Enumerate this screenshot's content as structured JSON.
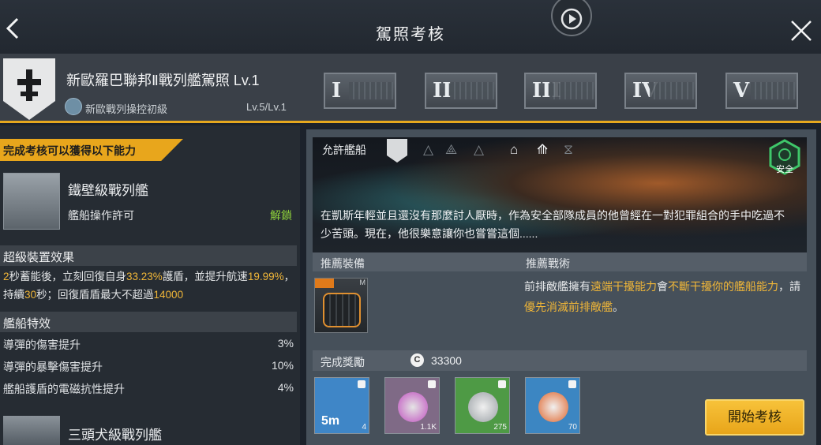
{
  "topbar": {
    "title": "駕照考核"
  },
  "header": {
    "license_title": "新歐羅巴聯邦Ⅱ戰列艦駕照 Lv.1",
    "skill_label": "新歐戰列操控初級",
    "skill_level": "Lv.5/Lv.1",
    "tiers": [
      "I",
      "II",
      "III",
      "IV",
      "V"
    ]
  },
  "left": {
    "ribbon": "完成考核可以獲得以下能力",
    "ship1": {
      "name": "鐵壁級戰列艦",
      "permission": "艦船操作許可",
      "unlock": "解鎖"
    },
    "super_equip_title": "超級裝置效果",
    "desc_parts": [
      "2",
      "秒蓄能後，立刻回復自身",
      "33.23%",
      "護盾，並提升航速",
      "19.99%",
      "，持續",
      "30",
      "秒；回復盾盾最大不超過",
      "14000"
    ],
    "special_title": "艦船特效",
    "effects": [
      {
        "label": "導彈的傷害提升",
        "value": "3%"
      },
      {
        "label": "導彈的暴擊傷害提升",
        "value": "10%"
      },
      {
        "label": "艦船護盾的電磁抗性提升",
        "value": "4%"
      }
    ],
    "ship2": {
      "name": "三頭犬級戰列艦"
    }
  },
  "right": {
    "allowed_label": "允許艦船",
    "safe_label": "安全",
    "story": "在凱斯年輕並且還沒有那麼討人厭時，作為安全部隊成員的他曾經在一對犯罪組合的手中吃過不少苦頭。現在，他很樂意讓你也嘗嘗這個......",
    "rec_equip_label": "推薦裝備",
    "rec_tactic_label": "推薦戰術",
    "equip_marker": "M",
    "tactic_parts": [
      "前排敵艦擁有",
      "遠端干擾能力",
      "會",
      "不斷干擾你的艦船能力",
      "，請",
      "優先消滅前排敵艦",
      "。"
    ],
    "reward_label": "完成獎勵",
    "coin_symbol": "C",
    "reward_amount": "33300",
    "rewards": [
      {
        "time": "5m",
        "count": "4",
        "color": "#3f86c7"
      },
      {
        "count": "1.1K",
        "color": "#7f6a86"
      },
      {
        "count": "275",
        "color": "#4e9a45"
      },
      {
        "count": "70",
        "color": "#3c86c2"
      }
    ],
    "start_button": "開始考核"
  }
}
